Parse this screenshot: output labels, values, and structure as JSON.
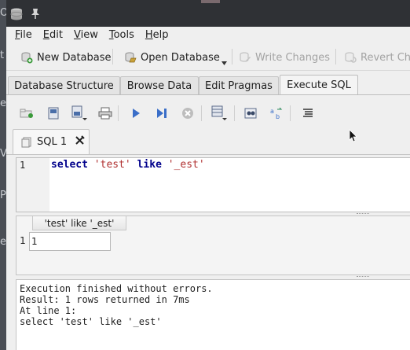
{
  "desktop": {
    "glyphs": [
      "O",
      "t",
      "es",
      "Vi",
      "P",
      "e"
    ]
  },
  "menu": [
    {
      "mnemonic": "F",
      "rest": "ile"
    },
    {
      "mnemonic": "E",
      "rest": "dit"
    },
    {
      "mnemonic": "V",
      "rest": "iew"
    },
    {
      "mnemonic": "T",
      "rest": "ools"
    },
    {
      "mnemonic": "H",
      "rest": "elp"
    }
  ],
  "toolbar": {
    "new_database": "New Database",
    "open_database": "Open Database",
    "write_changes": "Write Changes",
    "revert_changes": "Revert Cha"
  },
  "tabs": [
    {
      "label": "Database Structure"
    },
    {
      "label": "Browse Data"
    },
    {
      "label": "Edit Pragmas"
    },
    {
      "label": "Execute SQL",
      "active": true
    }
  ],
  "sql_tab": {
    "label": "SQL 1"
  },
  "editor": {
    "line_number": "1",
    "tokens": {
      "kw1": "select",
      "s1": "'test'",
      "kw2": "like",
      "s2": "'_est'"
    }
  },
  "results": {
    "column_header": "'test' like '_est'",
    "row_number": "1",
    "cell": "1"
  },
  "messages": [
    "Execution finished without errors.",
    "Result: 1 rows returned in 7ms",
    "At line 1:",
    "select 'test' like '_est'"
  ],
  "colors": {
    "titlebar": "#2f3135",
    "keyword": "#00008b",
    "string": "#b03030"
  },
  "icons": [
    "app-db-icon",
    "pin-icon",
    "new-database-icon",
    "open-database-icon",
    "write-changes-icon",
    "revert-changes-icon"
  ]
}
